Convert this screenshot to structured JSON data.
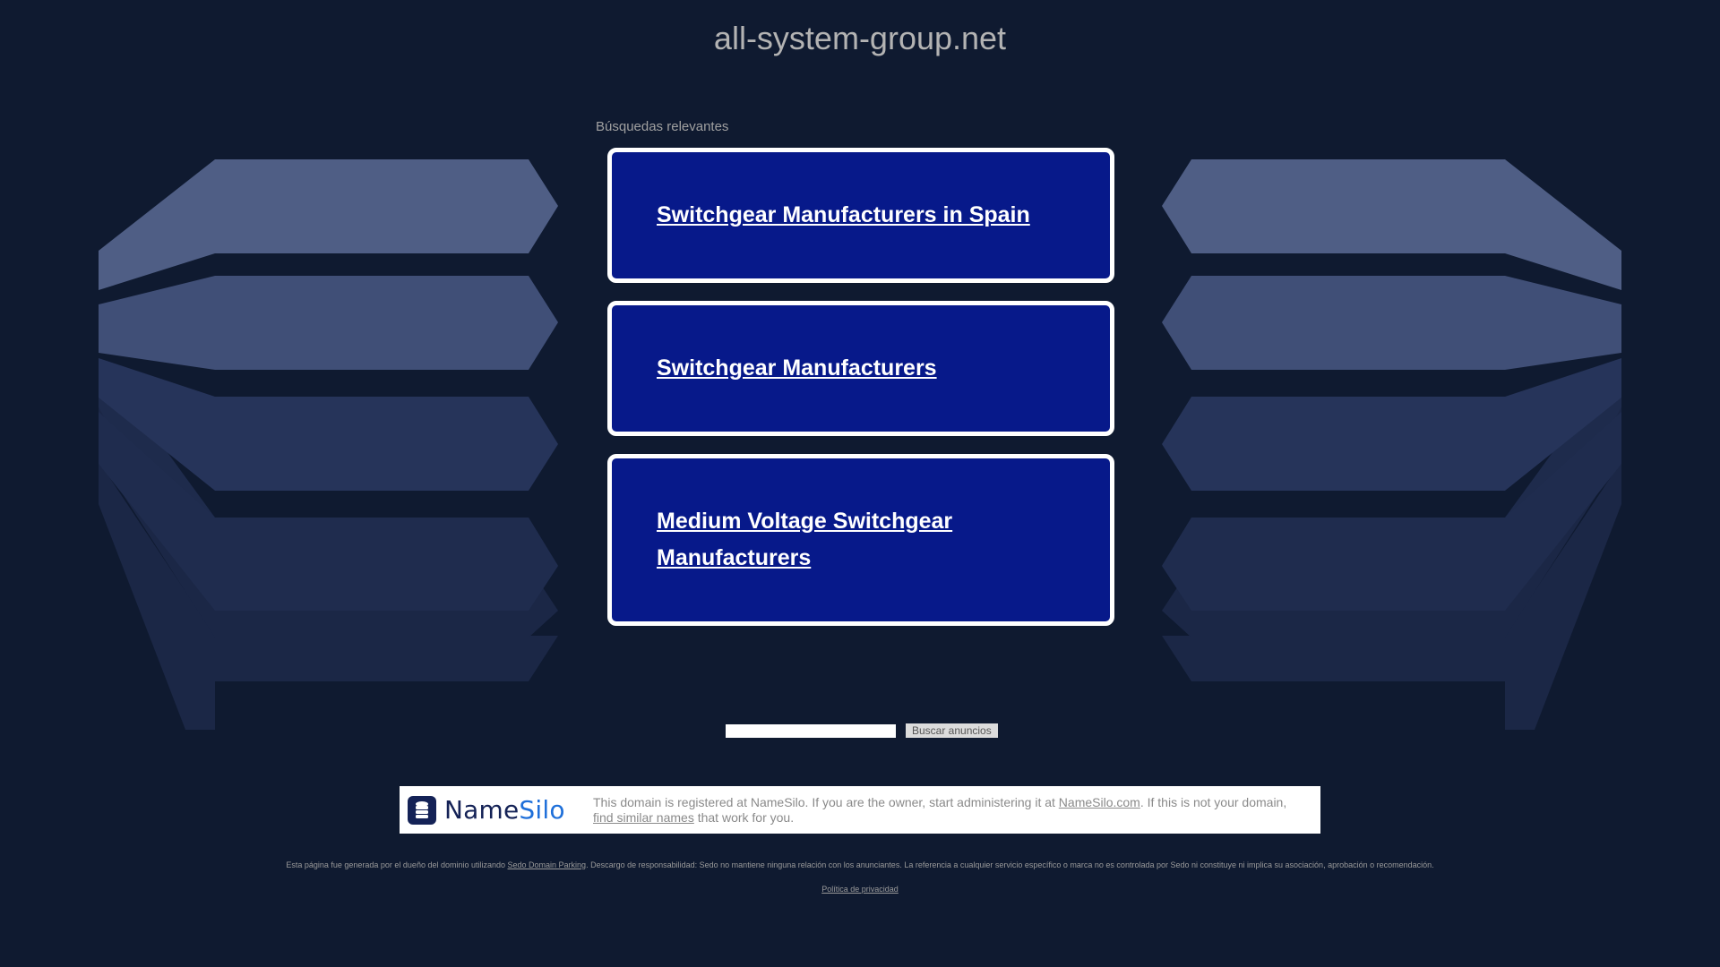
{
  "domain": "all-system-group.net",
  "related_searches_label": "Búsquedas relevantes",
  "ads": [
    {
      "label": "Switchgear Manufacturers in Spain"
    },
    {
      "label": "Switchgear Manufacturers"
    },
    {
      "label": "Medium Voltage Switchgear Manufacturers"
    }
  ],
  "search": {
    "value": "",
    "button_label": "Buscar anuncios"
  },
  "registrar": {
    "logo_part1": "Name",
    "logo_part2": "Silo",
    "text_before": "This domain is registered at NameSilo. If you are the owner, start administering it at ",
    "link1": "NameSilo.com",
    "text_middle": ". If this is not your domain, ",
    "link2": "find similar names",
    "text_after": " that work for you."
  },
  "footer": {
    "disclaimer_before": "Esta página fue generada por el dueño del dominio utilizando ",
    "disclaimer_link": "Sedo Domain Parking",
    "disclaimer_after": ". Descargo de responsabilidad: Sedo no mantiene ninguna relación con los anunciantes. La referencia a cualquier servicio específico o marca no es controlada por Sedo ni constituye ni implica su asociación, aprobación o recomendación.",
    "privacy_label": "Política de privacidad"
  },
  "colors": {
    "background": "#0f1a30",
    "ad_card": "#07198a",
    "card_border": "#ffffff"
  }
}
